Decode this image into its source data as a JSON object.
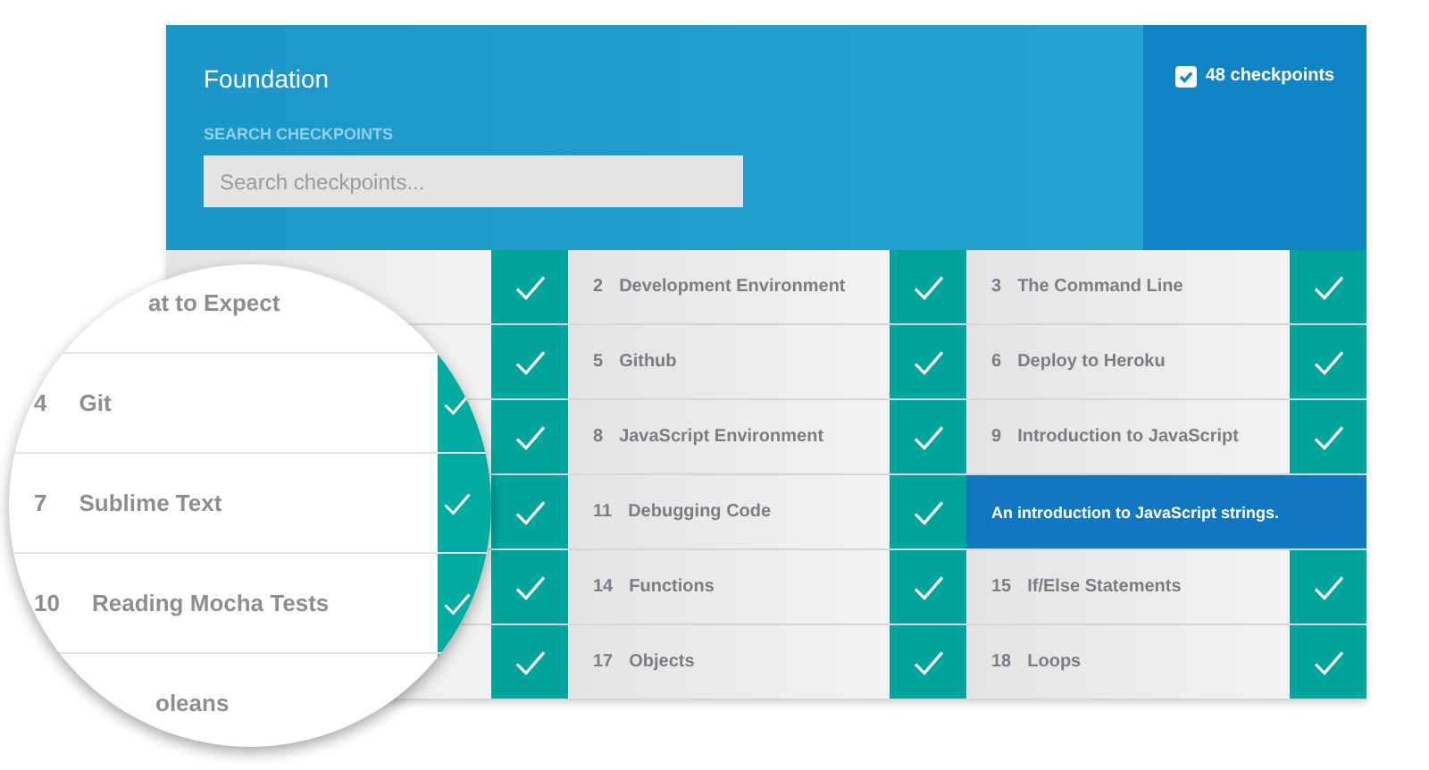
{
  "header": {
    "title": "Foundation",
    "search_label": "SEARCH CHECKPOINTS",
    "search": {
      "placeholder": "Search checkpoints..."
    },
    "count": {
      "label": "48 checkpoints",
      "checked": true
    }
  },
  "grid": {
    "column_1": [
      {
        "completed": true
      },
      {
        "completed": true
      },
      {
        "completed": true
      },
      {
        "completed": true
      },
      {
        "completed": true
      },
      {
        "completed": true
      }
    ],
    "items": [
      {
        "kind": "checkpoint",
        "number": "2",
        "title": "Development Environment",
        "completed": true
      },
      {
        "kind": "checkpoint",
        "number": "3",
        "title": "The Command Line",
        "completed": true
      },
      {
        "kind": "checkpoint",
        "number": "5",
        "title": "Github",
        "completed": true
      },
      {
        "kind": "checkpoint",
        "number": "6",
        "title": "Deploy to Heroku",
        "completed": true
      },
      {
        "kind": "checkpoint",
        "number": "8",
        "title": "JavaScript Environment",
        "completed": true
      },
      {
        "kind": "checkpoint",
        "number": "9",
        "title": "Introduction to JavaScript",
        "completed": true
      },
      {
        "kind": "checkpoint",
        "number": "11",
        "title": "Debugging Code",
        "completed": true
      },
      {
        "kind": "description",
        "text": "An introduction to JavaScript strings."
      },
      {
        "kind": "checkpoint",
        "number": "14",
        "title": "Functions",
        "completed": true
      },
      {
        "kind": "checkpoint",
        "number": "15",
        "title": "If/Else Statements",
        "completed": true
      },
      {
        "kind": "checkpoint",
        "number": "17",
        "title": "Objects",
        "completed": true
      },
      {
        "kind": "checkpoint",
        "number": "18",
        "title": "Loops",
        "completed": true
      }
    ]
  },
  "magnifier": {
    "rows": [
      {
        "title": "at to Expect"
      },
      {
        "number": "4",
        "title": "Git",
        "completed": true
      },
      {
        "number": "7",
        "title": "Sublime Text",
        "completed": true
      },
      {
        "number": "10",
        "title": "Reading Mocha Tests",
        "completed": true
      },
      {
        "title": "oleans"
      }
    ]
  }
}
